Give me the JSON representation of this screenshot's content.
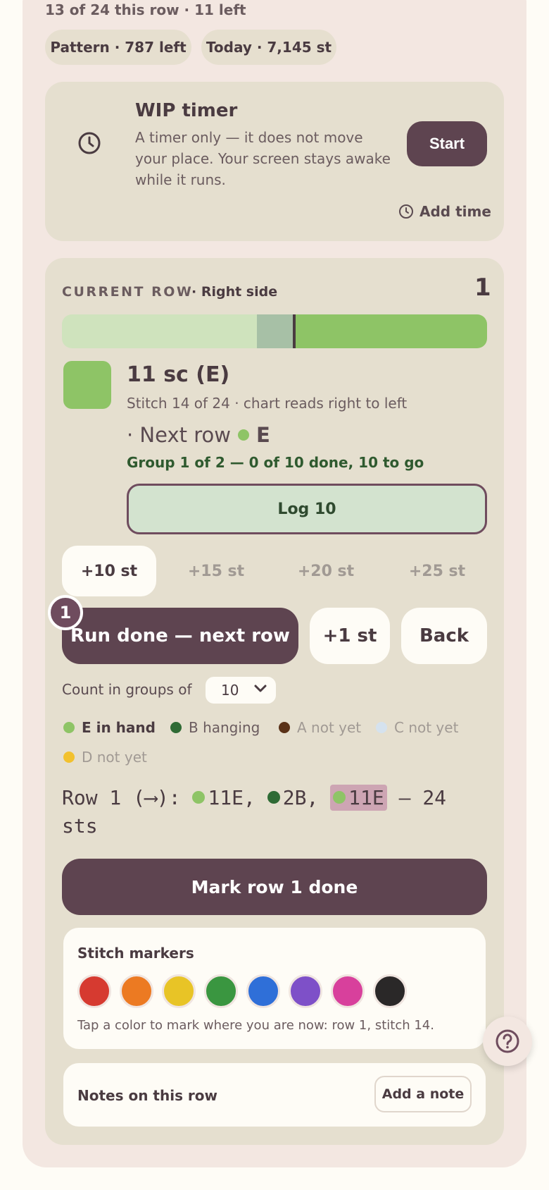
{
  "status": {
    "row_progress": "13 of 24 this row · 11 left",
    "chips": [
      "Pattern · 787 left",
      "Today · 7,145 st"
    ]
  },
  "timer": {
    "title": "WIP timer",
    "description": "A timer only — it does not move your place. Your screen stays awake while it runs.",
    "start_label": "Start",
    "add_time_label": "Add time",
    "icon": "clock-icon"
  },
  "current_row": {
    "label": "CURRENT ROW",
    "side": "· Right side",
    "number": "1",
    "progress_segments": [
      {
        "fraction": 0.458,
        "color": "#cfe3bd"
      },
      {
        "fraction": 0.09,
        "color": "#a7c0a6"
      },
      {
        "fraction": 0.452,
        "color": "#8ec466"
      }
    ],
    "swatch_color": "#8ec466",
    "stitch_name": "11 sc (E)",
    "stitch_position": "Stitch 14 of 24 · chart reads right to left",
    "next_row_prefix": "· Next row",
    "next_row_letter": "E",
    "next_row_color": "#8ec466",
    "group_status": "Group 1 of 2 — 0 of 10 done, 10 to go",
    "log_label": "Log 10"
  },
  "increments": [
    "+10 st",
    "+15 st",
    "+20 st",
    "+25 st"
  ],
  "actions": {
    "run_done_label": "Run done — next row",
    "badge": "1",
    "plus_one_label": "+1 st",
    "back_label": "Back"
  },
  "groups": {
    "label": "Count in groups of",
    "value": "10"
  },
  "legend": [
    {
      "text": "E in hand",
      "color": "#8ec466"
    },
    {
      "text": "B hanging",
      "color": "#2f6b35"
    },
    {
      "text": "A not yet",
      "color": "#5a3218"
    },
    {
      "text": "C not yet",
      "color": "#d5e2ee"
    },
    {
      "text": "D not yet",
      "color": "#f2c12e"
    }
  ],
  "row_line": {
    "prefix": "Row 1 (⟶): ",
    "parts": [
      {
        "text": "11E,",
        "color": "#8ec466"
      },
      {
        "text": "2B,",
        "color": "#2f6b35"
      },
      {
        "text": "11E",
        "color": "#8ec466"
      }
    ],
    "suffix": " — 24 sts"
  },
  "mark_done_label": "Mark row 1 done",
  "markers": {
    "title": "Stitch markers",
    "colors": [
      "#d63a30",
      "#ec7a22",
      "#e8c426",
      "#3a9640",
      "#2f6fd8",
      "#7e50c8",
      "#d8409c",
      "#2a2828"
    ],
    "help": "Tap a color to mark where you are now: row 1, stitch 14."
  },
  "notes": {
    "title": "Notes on this row",
    "add_label": "Add a note"
  },
  "help_icon": "question-icon"
}
